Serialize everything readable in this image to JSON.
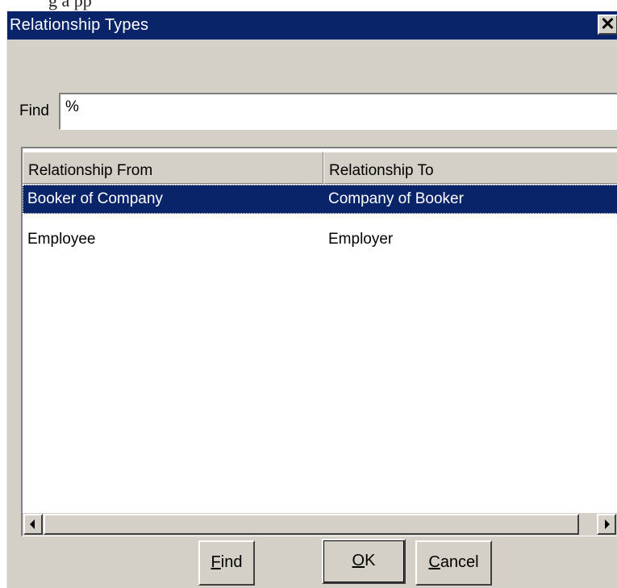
{
  "cutoff_caption": "g a pp",
  "dialog": {
    "title": "Relationship Types",
    "close_glyph": "✕"
  },
  "find": {
    "label": "Find",
    "value": "%"
  },
  "grid": {
    "columns": [
      "Relationship From",
      "Relationship To"
    ],
    "rows": [
      {
        "from": "Booker of Company",
        "to": "Company of Booker",
        "selected": true
      },
      {
        "from": "Employee",
        "to": "Employer",
        "selected": false
      }
    ]
  },
  "buttons": {
    "find": {
      "accel": "F",
      "rest": "ind"
    },
    "ok": {
      "accel": "O",
      "rest": "K"
    },
    "cancel": {
      "accel": "C",
      "rest": "ancel"
    }
  },
  "colors": {
    "titlebar": "#0a246a",
    "face": "#d4d0c8",
    "selection": "#0a246a"
  }
}
